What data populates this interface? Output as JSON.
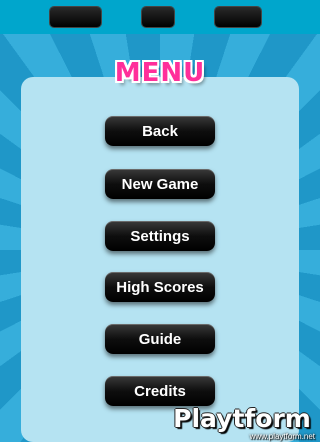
{
  "title": "MENU",
  "menu": {
    "items": [
      {
        "label": "Back"
      },
      {
        "label": "New Game"
      },
      {
        "label": "Settings"
      },
      {
        "label": "High Scores"
      },
      {
        "label": "Guide"
      },
      {
        "label": "Credits"
      }
    ]
  },
  "watermark": {
    "name": "Playtform",
    "url": "www.playtform.net"
  },
  "colors": {
    "title": "#ff2f9a",
    "panel": "#b5e3f2",
    "ray_light": "#36aedb",
    "ray_dark": "#1f97c8",
    "button": "#000000"
  }
}
